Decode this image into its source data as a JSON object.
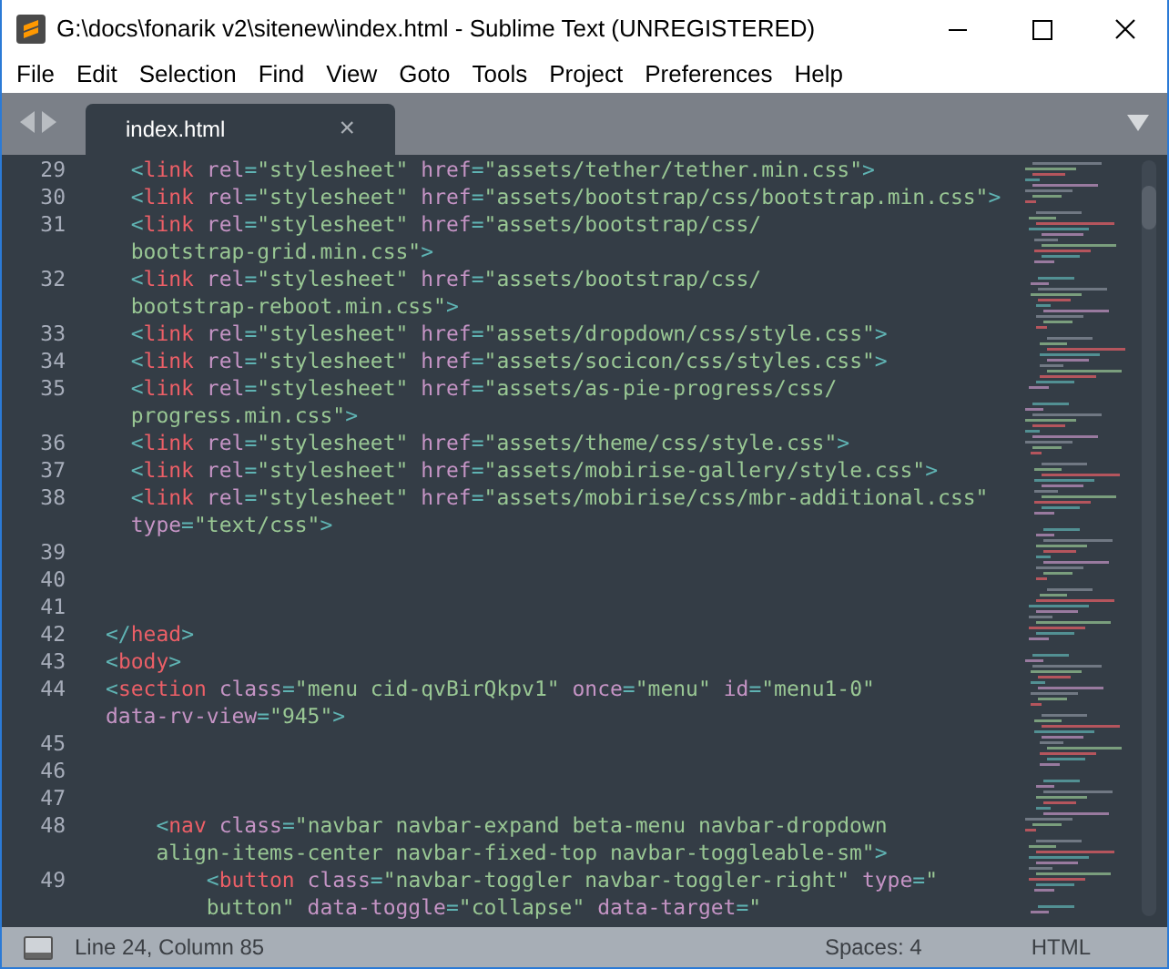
{
  "window": {
    "title": "G:\\docs\\fonarik v2\\sitenew\\index.html - Sublime Text (UNREGISTERED)"
  },
  "menu": [
    "File",
    "Edit",
    "Selection",
    "Find",
    "View",
    "Goto",
    "Tools",
    "Project",
    "Preferences",
    "Help"
  ],
  "tabs": [
    {
      "label": "index.html",
      "selected": true,
      "close": "×"
    }
  ],
  "code": [
    {
      "number": "29",
      "rows": [
        {
          "tokens": [
            {
              "kind": "p",
              "text": "  <"
            },
            {
              "kind": "t",
              "text": "link"
            },
            {
              "kind": "a",
              "text": " rel"
            },
            {
              "kind": "p",
              "text": "="
            },
            {
              "kind": "s",
              "text": "\"stylesheet\""
            },
            {
              "kind": "a",
              "text": " href"
            },
            {
              "kind": "p",
              "text": "="
            },
            {
              "kind": "s",
              "text": "\"assets/tether/tether.min.css\""
            },
            {
              "kind": "p",
              "text": ">"
            }
          ]
        }
      ]
    },
    {
      "number": "30",
      "rows": [
        {
          "tokens": [
            {
              "kind": "p",
              "text": "  <"
            },
            {
              "kind": "t",
              "text": "link"
            },
            {
              "kind": "a",
              "text": " rel"
            },
            {
              "kind": "p",
              "text": "="
            },
            {
              "kind": "s",
              "text": "\"stylesheet\""
            },
            {
              "kind": "a",
              "text": " href"
            },
            {
              "kind": "p",
              "text": "="
            },
            {
              "kind": "s",
              "text": "\"assets/bootstrap/css/bootstrap.min.css\""
            },
            {
              "kind": "p",
              "text": ">"
            }
          ]
        }
      ]
    },
    {
      "number": "31",
      "rows": [
        {
          "tokens": [
            {
              "kind": "p",
              "text": "  <"
            },
            {
              "kind": "t",
              "text": "link"
            },
            {
              "kind": "a",
              "text": " rel"
            },
            {
              "kind": "p",
              "text": "="
            },
            {
              "kind": "s",
              "text": "\"stylesheet\""
            },
            {
              "kind": "a",
              "text": " href"
            },
            {
              "kind": "p",
              "text": "="
            },
            {
              "kind": "s",
              "text": "\"assets/bootstrap/css/"
            }
          ]
        },
        {
          "tokens": [
            {
              "kind": "s",
              "text": "  bootstrap-grid.min.css\""
            },
            {
              "kind": "p",
              "text": ">"
            }
          ]
        }
      ]
    },
    {
      "number": "32",
      "rows": [
        {
          "tokens": [
            {
              "kind": "p",
              "text": "  <"
            },
            {
              "kind": "t",
              "text": "link"
            },
            {
              "kind": "a",
              "text": " rel"
            },
            {
              "kind": "p",
              "text": "="
            },
            {
              "kind": "s",
              "text": "\"stylesheet\""
            },
            {
              "kind": "a",
              "text": " href"
            },
            {
              "kind": "p",
              "text": "="
            },
            {
              "kind": "s",
              "text": "\"assets/bootstrap/css/"
            }
          ]
        },
        {
          "tokens": [
            {
              "kind": "s",
              "text": "  bootstrap-reboot.min.css\""
            },
            {
              "kind": "p",
              "text": ">"
            }
          ]
        }
      ]
    },
    {
      "number": "33",
      "rows": [
        {
          "tokens": [
            {
              "kind": "p",
              "text": "  <"
            },
            {
              "kind": "t",
              "text": "link"
            },
            {
              "kind": "a",
              "text": " rel"
            },
            {
              "kind": "p",
              "text": "="
            },
            {
              "kind": "s",
              "text": "\"stylesheet\""
            },
            {
              "kind": "a",
              "text": " href"
            },
            {
              "kind": "p",
              "text": "="
            },
            {
              "kind": "s",
              "text": "\"assets/dropdown/css/style.css\""
            },
            {
              "kind": "p",
              "text": ">"
            }
          ]
        }
      ]
    },
    {
      "number": "34",
      "rows": [
        {
          "tokens": [
            {
              "kind": "p",
              "text": "  <"
            },
            {
              "kind": "t",
              "text": "link"
            },
            {
              "kind": "a",
              "text": " rel"
            },
            {
              "kind": "p",
              "text": "="
            },
            {
              "kind": "s",
              "text": "\"stylesheet\""
            },
            {
              "kind": "a",
              "text": " href"
            },
            {
              "kind": "p",
              "text": "="
            },
            {
              "kind": "s",
              "text": "\"assets/socicon/css/styles.css\""
            },
            {
              "kind": "p",
              "text": ">"
            }
          ]
        }
      ]
    },
    {
      "number": "35",
      "rows": [
        {
          "tokens": [
            {
              "kind": "p",
              "text": "  <"
            },
            {
              "kind": "t",
              "text": "link"
            },
            {
              "kind": "a",
              "text": " rel"
            },
            {
              "kind": "p",
              "text": "="
            },
            {
              "kind": "s",
              "text": "\"stylesheet\""
            },
            {
              "kind": "a",
              "text": " href"
            },
            {
              "kind": "p",
              "text": "="
            },
            {
              "kind": "s",
              "text": "\"assets/as-pie-progress/css/"
            }
          ]
        },
        {
          "tokens": [
            {
              "kind": "s",
              "text": "  progress.min.css\""
            },
            {
              "kind": "p",
              "text": ">"
            }
          ]
        }
      ]
    },
    {
      "number": "36",
      "rows": [
        {
          "tokens": [
            {
              "kind": "p",
              "text": "  <"
            },
            {
              "kind": "t",
              "text": "link"
            },
            {
              "kind": "a",
              "text": " rel"
            },
            {
              "kind": "p",
              "text": "="
            },
            {
              "kind": "s",
              "text": "\"stylesheet\""
            },
            {
              "kind": "a",
              "text": " href"
            },
            {
              "kind": "p",
              "text": "="
            },
            {
              "kind": "s",
              "text": "\"assets/theme/css/style.css\""
            },
            {
              "kind": "p",
              "text": ">"
            }
          ]
        }
      ]
    },
    {
      "number": "37",
      "rows": [
        {
          "tokens": [
            {
              "kind": "p",
              "text": "  <"
            },
            {
              "kind": "t",
              "text": "link"
            },
            {
              "kind": "a",
              "text": " rel"
            },
            {
              "kind": "p",
              "text": "="
            },
            {
              "kind": "s",
              "text": "\"stylesheet\""
            },
            {
              "kind": "a",
              "text": " href"
            },
            {
              "kind": "p",
              "text": "="
            },
            {
              "kind": "s",
              "text": "\"assets/mobirise-gallery/style.css\""
            },
            {
              "kind": "p",
              "text": ">"
            }
          ]
        }
      ]
    },
    {
      "number": "38",
      "rows": [
        {
          "tokens": [
            {
              "kind": "p",
              "text": "  <"
            },
            {
              "kind": "t",
              "text": "link"
            },
            {
              "kind": "a",
              "text": " rel"
            },
            {
              "kind": "p",
              "text": "="
            },
            {
              "kind": "s",
              "text": "\"stylesheet\""
            },
            {
              "kind": "a",
              "text": " href"
            },
            {
              "kind": "p",
              "text": "="
            },
            {
              "kind": "s",
              "text": "\"assets/mobirise/css/mbr-additional.css\""
            }
          ]
        },
        {
          "tokens": [
            {
              "kind": "a",
              "text": "  type"
            },
            {
              "kind": "p",
              "text": "="
            },
            {
              "kind": "s",
              "text": "\"text/css\""
            },
            {
              "kind": "p",
              "text": ">"
            }
          ]
        }
      ]
    },
    {
      "number": "39"
    },
    {
      "number": "40"
    },
    {
      "number": "41"
    },
    {
      "number": "42",
      "rows": [
        {
          "tokens": [
            {
              "kind": "p",
              "text": "</"
            },
            {
              "kind": "t",
              "text": "head"
            },
            {
              "kind": "p",
              "text": ">"
            }
          ]
        }
      ]
    },
    {
      "number": "43",
      "rows": [
        {
          "tokens": [
            {
              "kind": "p",
              "text": "<"
            },
            {
              "kind": "t",
              "text": "body"
            },
            {
              "kind": "p",
              "text": ">"
            }
          ]
        }
      ]
    },
    {
      "number": "44",
      "rows": [
        {
          "tokens": [
            {
              "kind": "p",
              "text": "<"
            },
            {
              "kind": "t",
              "text": "section"
            },
            {
              "kind": "a",
              "text": " class"
            },
            {
              "kind": "p",
              "text": "="
            },
            {
              "kind": "s",
              "text": "\"menu cid-qvBirQkpv1\""
            },
            {
              "kind": "a",
              "text": " once"
            },
            {
              "kind": "p",
              "text": "="
            },
            {
              "kind": "s",
              "text": "\"menu\""
            },
            {
              "kind": "a",
              "text": " id"
            },
            {
              "kind": "p",
              "text": "="
            },
            {
              "kind": "s",
              "text": "\"menu1-0\""
            }
          ]
        },
        {
          "tokens": [
            {
              "kind": "a",
              "text": "data-rv-view"
            },
            {
              "kind": "p",
              "text": "="
            },
            {
              "kind": "s",
              "text": "\"945\""
            },
            {
              "kind": "p",
              "text": ">"
            }
          ]
        }
      ]
    },
    {
      "number": "45"
    },
    {
      "number": "46"
    },
    {
      "number": "47"
    },
    {
      "number": "48",
      "rows": [
        {
          "tokens": [
            {
              "kind": "p",
              "text": "    <"
            },
            {
              "kind": "t",
              "text": "nav"
            },
            {
              "kind": "a",
              "text": " class"
            },
            {
              "kind": "p",
              "text": "="
            },
            {
              "kind": "s",
              "text": "\"navbar navbar-expand beta-menu navbar-dropdown"
            }
          ]
        },
        {
          "tokens": [
            {
              "kind": "s",
              "text": "    align-items-center navbar-fixed-top navbar-toggleable-sm\""
            },
            {
              "kind": "p",
              "text": ">"
            }
          ]
        }
      ]
    },
    {
      "number": "49",
      "rows": [
        {
          "tokens": [
            {
              "kind": "p",
              "text": "        <"
            },
            {
              "kind": "t",
              "text": "button"
            },
            {
              "kind": "a",
              "text": " class"
            },
            {
              "kind": "p",
              "text": "="
            },
            {
              "kind": "s",
              "text": "\"navbar-toggler navbar-toggler-right\""
            },
            {
              "kind": "a",
              "text": " type"
            },
            {
              "kind": "p",
              "text": "="
            },
            {
              "kind": "s",
              "text": "\""
            }
          ]
        },
        {
          "tokens": [
            {
              "kind": "s",
              "text": "        button\""
            },
            {
              "kind": "a",
              "text": " data-toggle"
            },
            {
              "kind": "p",
              "text": "="
            },
            {
              "kind": "s",
              "text": "\"collapse\""
            },
            {
              "kind": "a",
              "text": " data-target"
            },
            {
              "kind": "p",
              "text": "="
            },
            {
              "kind": "s",
              "text": "\""
            }
          ]
        }
      ]
    }
  ],
  "status_bar": {
    "position": "Line 24, Column 85",
    "indentation": "Spaces: 4",
    "syntax": "HTML"
  }
}
